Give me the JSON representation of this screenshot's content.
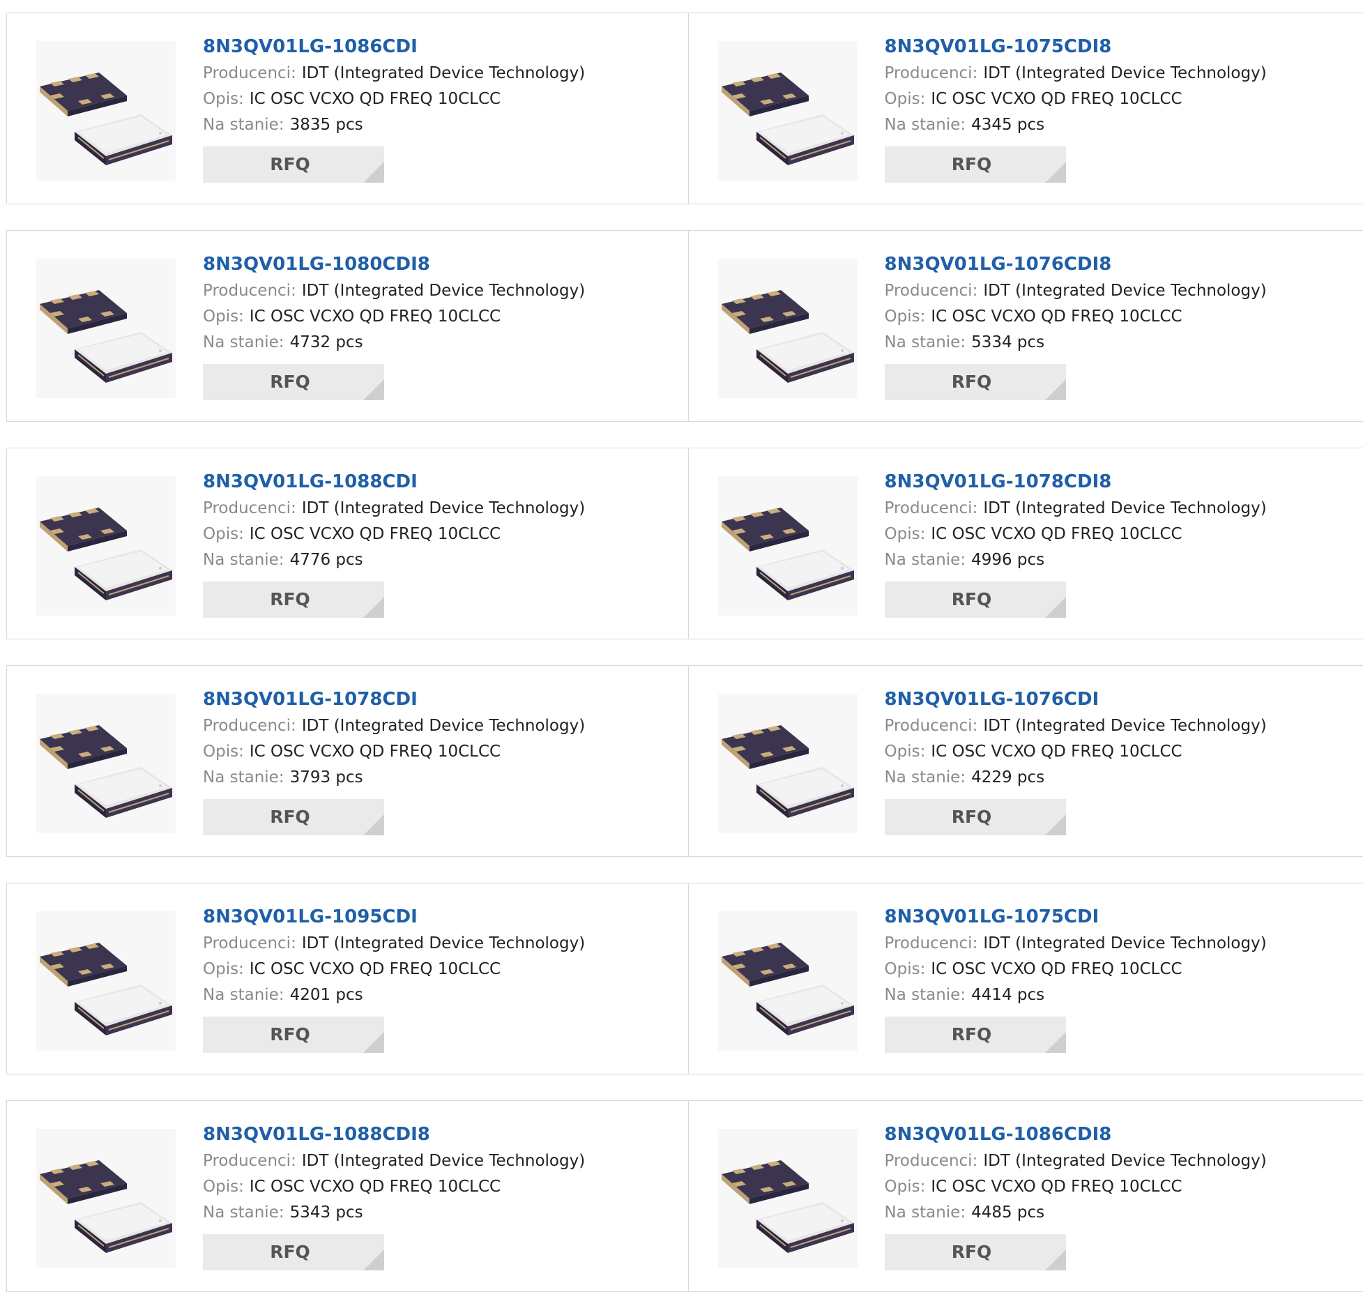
{
  "labels": {
    "manufacturer": "Producenci:",
    "description": "Opis:",
    "stock": "Na stanie:",
    "rfq": "RFQ"
  },
  "products": [
    {
      "part": "8N3QV01LG-1086CDI",
      "manufacturer": "IDT (Integrated Device Technology)",
      "description": "IC OSC VCXO QD FREQ 10CLCC",
      "stock": "3835 pcs"
    },
    {
      "part": "8N3QV01LG-1075CDI8",
      "manufacturer": "IDT (Integrated Device Technology)",
      "description": "IC OSC VCXO QD FREQ 10CLCC",
      "stock": "4345 pcs"
    },
    {
      "part": "8N3QV01LG-1080CDI8",
      "manufacturer": "IDT (Integrated Device Technology)",
      "description": "IC OSC VCXO QD FREQ 10CLCC",
      "stock": "4732 pcs"
    },
    {
      "part": "8N3QV01LG-1076CDI8",
      "manufacturer": "IDT (Integrated Device Technology)",
      "description": "IC OSC VCXO QD FREQ 10CLCC",
      "stock": "5334 pcs"
    },
    {
      "part": "8N3QV01LG-1088CDI",
      "manufacturer": "IDT (Integrated Device Technology)",
      "description": "IC OSC VCXO QD FREQ 10CLCC",
      "stock": "4776 pcs"
    },
    {
      "part": "8N3QV01LG-1078CDI8",
      "manufacturer": "IDT (Integrated Device Technology)",
      "description": "IC OSC VCXO QD FREQ 10CLCC",
      "stock": "4996 pcs"
    },
    {
      "part": "8N3QV01LG-1078CDI",
      "manufacturer": "IDT (Integrated Device Technology)",
      "description": "IC OSC VCXO QD FREQ 10CLCC",
      "stock": "3793 pcs"
    },
    {
      "part": "8N3QV01LG-1076CDI",
      "manufacturer": "IDT (Integrated Device Technology)",
      "description": "IC OSC VCXO QD FREQ 10CLCC",
      "stock": "4229 pcs"
    },
    {
      "part": "8N3QV01LG-1095CDI",
      "manufacturer": "IDT (Integrated Device Technology)",
      "description": "IC OSC VCXO QD FREQ 10CLCC",
      "stock": "4201 pcs"
    },
    {
      "part": "8N3QV01LG-1075CDI",
      "manufacturer": "IDT (Integrated Device Technology)",
      "description": "IC OSC VCXO QD FREQ 10CLCC",
      "stock": "4414 pcs"
    },
    {
      "part": "8N3QV01LG-1088CDI8",
      "manufacturer": "IDT (Integrated Device Technology)",
      "description": "IC OSC VCXO QD FREQ 10CLCC",
      "stock": "5343 pcs"
    },
    {
      "part": "8N3QV01LG-1086CDI8",
      "manufacturer": "IDT (Integrated Device Technology)",
      "description": "IC OSC VCXO QD FREQ 10CLCC",
      "stock": "4485 pcs"
    }
  ],
  "colors": {
    "link": "#1f5fa8",
    "label": "#8a8a8a",
    "button_bg": "#eaeaea"
  },
  "icons": {
    "product_thumb": "oscillator-chip-image"
  }
}
